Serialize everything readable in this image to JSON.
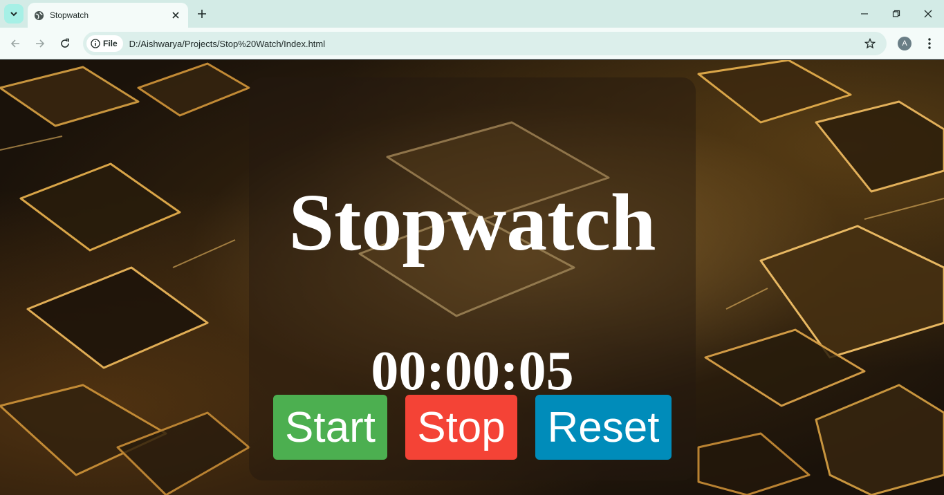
{
  "browser": {
    "tab_title": "Stopwatch",
    "address_chip": "File",
    "url": "D:/Aishwarya/Projects/Stop%20Watch/Index.html",
    "profile_initial": "A"
  },
  "page": {
    "heading": "Stopwatch",
    "time_display": "00:00:05",
    "buttons": {
      "start": "Start",
      "stop": "Stop",
      "reset": "Reset"
    }
  },
  "colors": {
    "start": "#4caf50",
    "stop": "#f44336",
    "reset": "#008cba"
  }
}
